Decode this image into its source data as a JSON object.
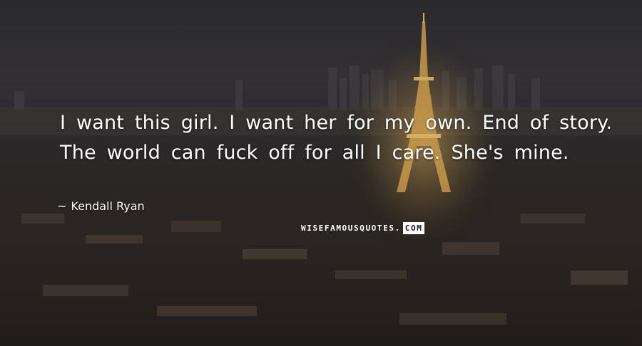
{
  "quote": {
    "text": "I want this girl. I want her for my own. End of story. The world can fuck off for all I care. She's mine.",
    "author_dash": "~",
    "author": "Kendall Ryan"
  },
  "watermark": {
    "main": "WISEFAMOUSQUOTES.",
    "suffix": "COM"
  },
  "background": {
    "subject": "night skyline of Paris with illuminated Eiffel Tower",
    "tower_glow_color": "#e0b25a",
    "sky_color": "#302e31",
    "ground_color": "#2a2420"
  }
}
